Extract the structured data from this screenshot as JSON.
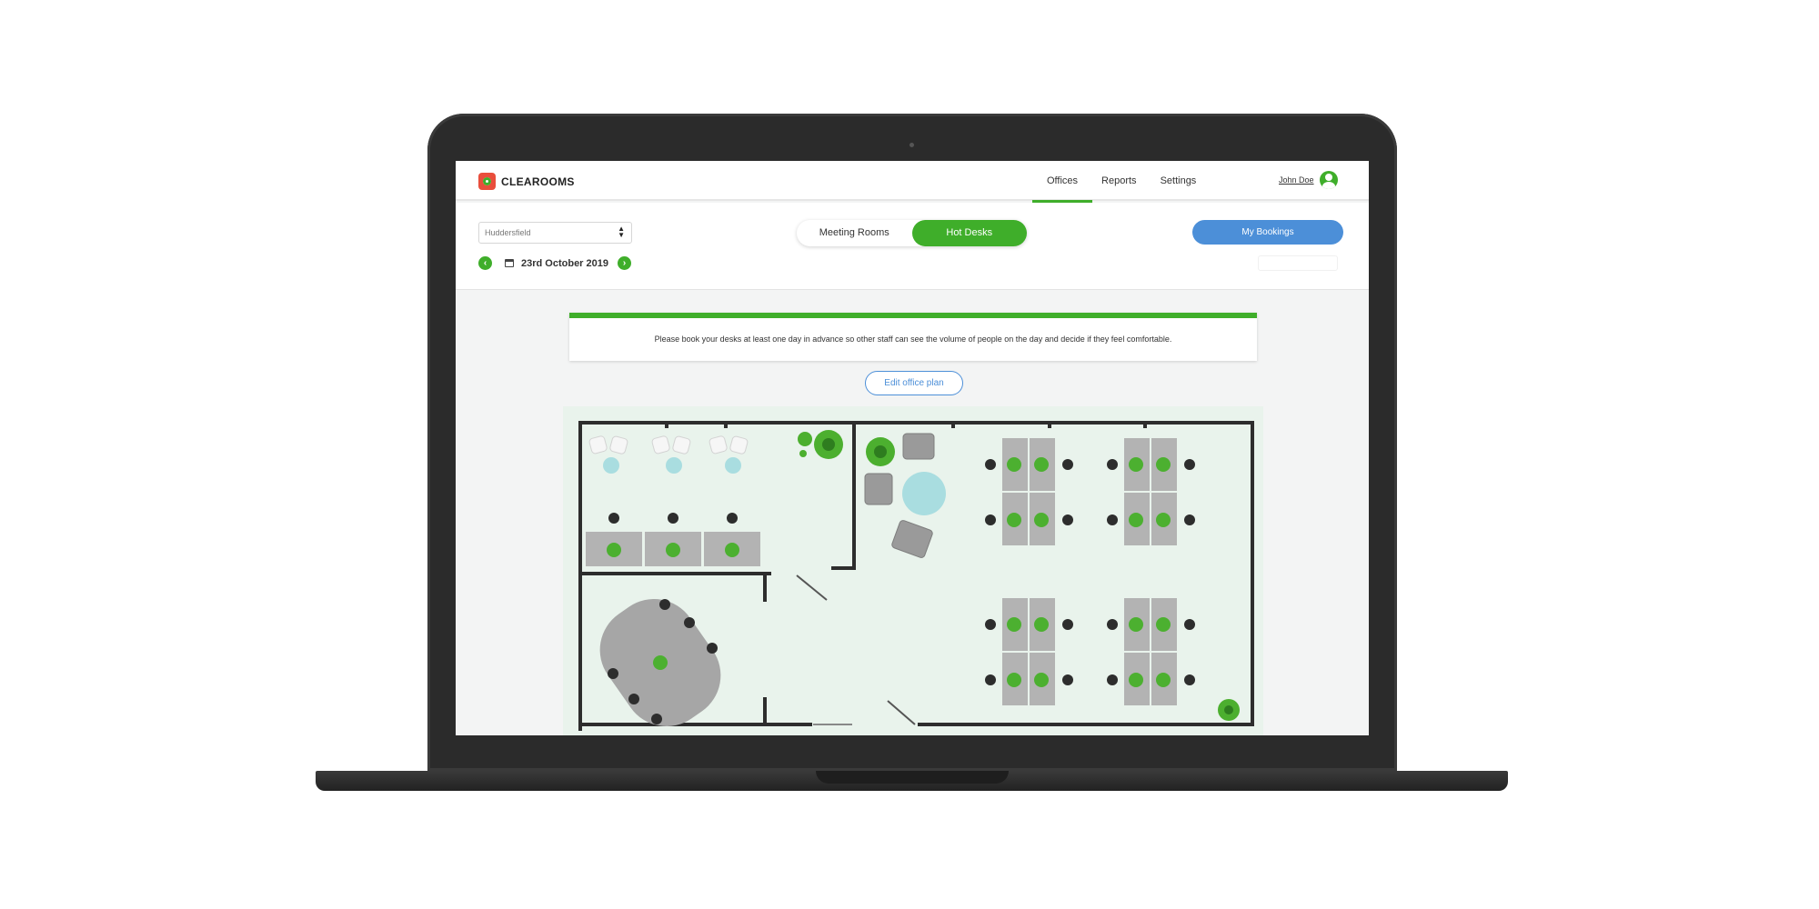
{
  "app": {
    "name": "CLEAROOMS"
  },
  "nav": {
    "links": [
      "Offices",
      "Reports",
      "Settings"
    ],
    "active": "Offices",
    "user_name": "John Doe"
  },
  "toolbar": {
    "office": "Huddersfield",
    "date": "23rd October 2019",
    "toggle": [
      "Meeting Rooms",
      "Hot Desks"
    ],
    "toggle_active": "Hot Desks",
    "my_bookings": "My Bookings"
  },
  "notice": "Please book your desks at least one day in advance so other staff can see the volume of people on the day and decide if they feel comfortable.",
  "edit_plan": "Edit office plan",
  "colors": {
    "accent": "#3fae2a",
    "blue": "#4c8fd8",
    "floor": "#e9f3ec",
    "desk": "#b3b3b3"
  }
}
